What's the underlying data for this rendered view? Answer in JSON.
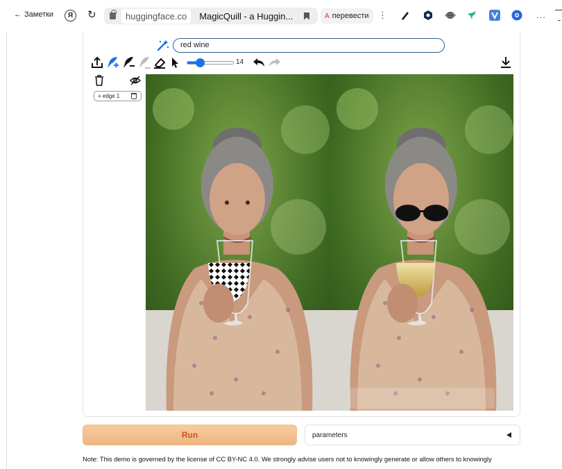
{
  "browser": {
    "back_label": "Заметки",
    "yandex_letter": "Я",
    "domain": "huggingface.co",
    "page_title": "MagicQuill - a Huggin...",
    "translate_label": "перевести",
    "translate_icon": "A",
    "menu_glyph": "⋮",
    "overflow_glyph": "...",
    "extensions": [
      "pen-icon",
      "hexagon-icon",
      "sphere-icon",
      "bird-icon",
      "v-icon",
      "circle-icon"
    ]
  },
  "editor": {
    "prompt_value": "red wine",
    "brush_size": 14,
    "brush_max": 50,
    "layers": [
      {
        "label": "+ edge 1"
      }
    ]
  },
  "actions": {
    "run_label": "Run",
    "parameters_label": "parameters"
  },
  "note": {
    "text": "Note: This demo is governed by the license of CC BY-NC 4.0. We strongly advise users not to knowingly generate or allow others to knowingly"
  },
  "colors": {
    "accent": "#1a73e8",
    "prompt_border": "#2a5c90",
    "run_bg": "#f2c08f",
    "run_text": "#c8561a"
  }
}
